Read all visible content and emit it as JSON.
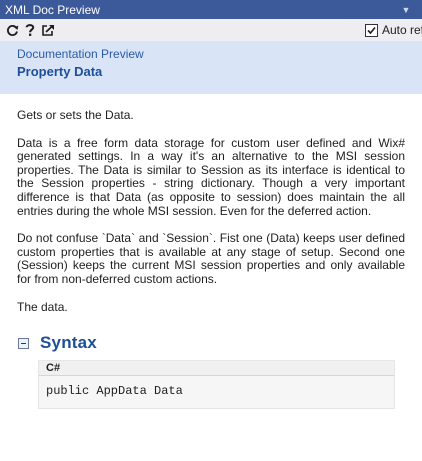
{
  "window": {
    "title": "XML Doc Preview"
  },
  "toolbar": {
    "refresh_icon": "refresh-icon",
    "help_icon": "help-icon",
    "goto_icon": "goto-source-icon",
    "auto_refresh_label": "Auto ref",
    "auto_refresh_checked": true
  },
  "header": {
    "subtitle": "Documentation Preview",
    "title": "Property Data"
  },
  "content": {
    "summary": "Gets or sets the Data.",
    "remarks": [
      "Data is a free form data storage for custom user defined and Wix# generated settings. In a way it's an alternative to the MSI session properties. The Data is similar to Session as its interface is identical to the Session properties - string dictionary. Though a very important difference is that Data (as opposite to session) does maintain the all entries during the whole MSI session. Even for the deferred action.",
      "Do not confuse `Data` and `Session`. Fist one (Data) keeps user defined custom properties that is available at any stage of setup. Second one (Session) keeps the current MSI session properties and only available for from non-deferred custom actions."
    ],
    "value": "The data."
  },
  "syntax": {
    "heading": "Syntax",
    "language": "C#",
    "code": "public AppData Data"
  },
  "colors": {
    "title_bar": "#3c5a9a",
    "header_band": "#dae4f7",
    "heading_blue": "#1d4f98"
  }
}
